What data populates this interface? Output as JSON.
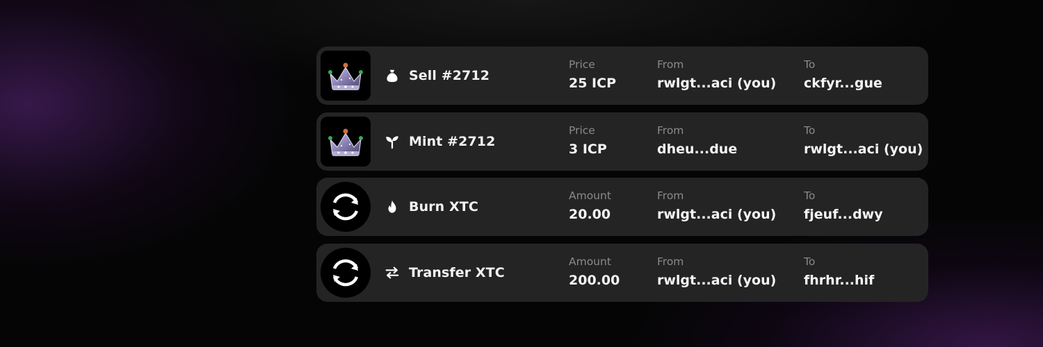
{
  "colors": {
    "card_bg": "#242424",
    "page_bg": "#050505",
    "glow": "#5f2882",
    "label_gray": "#8a8a8a",
    "text_white": "#f5f5f5"
  },
  "transactions": [
    {
      "thumbnail": "crown-nft-image",
      "type_icon": "money-bag-icon",
      "title": "Sell #2712",
      "col1_label": "Price",
      "col1_value": "25 ICP",
      "from_label": "From",
      "from_value": "rwlgt...aci (you)",
      "to_label": "To",
      "to_value": "ckfyr...gue"
    },
    {
      "thumbnail": "crown-nft-image",
      "type_icon": "sprout-icon",
      "title": "Mint #2712",
      "col1_label": "Price",
      "col1_value": "3 ICP",
      "from_label": "From",
      "from_value": "dheu...due",
      "to_label": "To",
      "to_value": "rwlgt...aci (you)"
    },
    {
      "thumbnail": "xtc-token-icon",
      "type_icon": "flame-icon",
      "title": "Burn XTC",
      "col1_label": "Amount",
      "col1_value": "20.00",
      "from_label": "From",
      "from_value": "rwlgt...aci (you)",
      "to_label": "To",
      "to_value": "fjeuf...dwy"
    },
    {
      "thumbnail": "xtc-token-icon",
      "type_icon": "transfer-arrows-icon",
      "title": "Transfer XTC",
      "col1_label": "Amount",
      "col1_value": "200.00",
      "from_label": "From",
      "from_value": "rwlgt...aci (you)",
      "to_label": "To",
      "to_value": "fhrhr...hif"
    }
  ]
}
